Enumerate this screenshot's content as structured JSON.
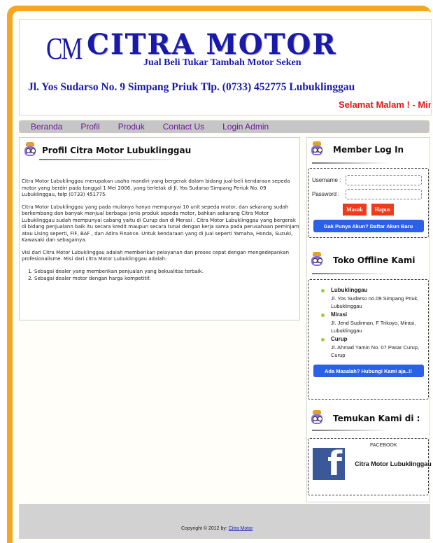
{
  "header": {
    "logo": "CM",
    "brand": "CITRA MOTOR",
    "tagline": "Jual Beli Tukar Tambah Motor Seken",
    "address": "Jl. Yos Sudarso No. 9 Simpang Priuk Tlp. (0733) 452775 Lubuklinggau",
    "marquee": "Selamat Malam ! - Ming"
  },
  "nav": [
    "Beranda",
    "Profil",
    "Produk",
    "Contact Us",
    "Login Admin"
  ],
  "main": {
    "title": "Profil Citra Motor Lubuklinggau",
    "paragraphs": [
      "Citra Motor Lubuklinggau merupakan usaha mandiri yang bergerak  dalam bidang jual-beli kendaraan sepeda motor yang berdiri pada tanggal 1 Mei 2006, yang terletak di Jl. Yos Sudarso Simpang Periuk No. 09 Lubuklinggau, telp (0733) 451775.",
      "Citra Motor Lubuklinggau yang pada mulanya hanya mempunyai 10 unit sepeda motor, dan sekarang sudah berkembang  dan banyak menjual berbagai jenis produk sepeda motor, bahkan sekarang Citra Motor Lubuklinggau sudah mempunyai cabang yaitu di Curup dan di Merasi . Citra Motor Lubuklinggau yang bergerak di bidang penjualann baik itu secara kredit maupun secara tunai dengan kerja sama pada perusahaan peminjam atau Lising seperti, FIF, BAF , dan Adira Finance. Untuk kendaraan yang di jual seperti Yamaha, Honda, Suzuki, Kawasaki dan sebagainya.",
      "Visi dari Citra Motor Lubuklinggau adalah memberikan pelayanan dan proses cepat dengan mengedepankan profesionalisme. Misi dari citra Motor Lubuklinggau adalah:"
    ],
    "list": [
      "Sebagai dealer yang memberikan penjualan yang bekualitas terbaik.",
      "Sebagai dealer motor dengan harga kompetitif."
    ]
  },
  "login": {
    "title": "Member Log In",
    "username_label": "Username :",
    "password_label": "Password :",
    "submit_label": "Masuk",
    "reset_label": "Hapus",
    "register_label": "Gak Punya Akun? Daftar Akun Baru"
  },
  "stores": {
    "title": "Toko Offline Kami",
    "items": [
      {
        "city": "Lubuklinggau",
        "address": "Jl. Yos Sudarso no.09 Simpang Priuk, Lubuklinggau"
      },
      {
        "city": "Mirasi",
        "address": "Jl. Jend Sudirman, F Trikoyo, Mirasi, Lubuklinggau"
      },
      {
        "city": "Curup",
        "address": "Jl. Ahmad Yamin No. 07 Pasar Curup, Curup"
      }
    ],
    "contact_label": "Ada Masalah? Hubungi Kami aja..!!"
  },
  "social": {
    "title": "Temukan Kami di :",
    "fb_label": "FACEBOOK",
    "fb_name": "Citra Motor Lubuklinggau"
  },
  "footer": {
    "text": "Copyright © 2012 by:",
    "link": "Citra Motor"
  }
}
